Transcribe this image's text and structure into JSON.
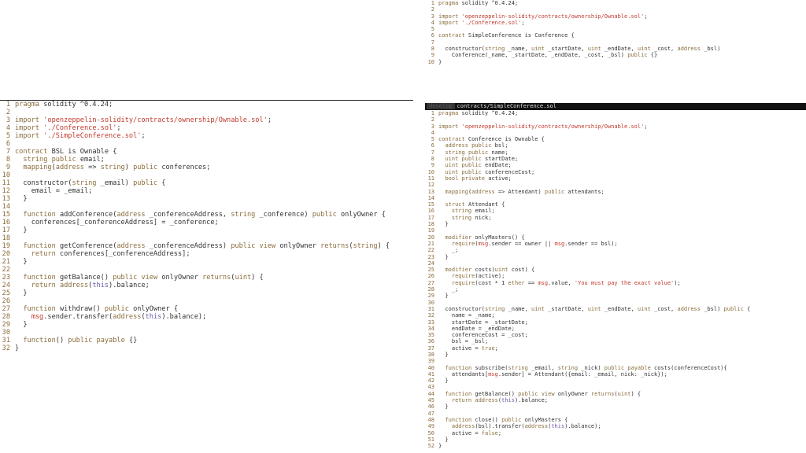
{
  "theme": {
    "keyword": "#8a6d3b",
    "string": "#c0392b",
    "type": "#6c5ba8",
    "text": "#333333"
  },
  "top_pane": {
    "lines": [
      [
        [
          "kw",
          "pragma"
        ],
        [
          "p",
          " solidity ^0.4.24;"
        ]
      ],
      [],
      [
        [
          "kw",
          "import"
        ],
        [
          "p",
          " "
        ],
        [
          "str",
          "'openzeppelin-solidity/contracts/ownership/Ownable.sol'"
        ],
        [
          "p",
          ";"
        ]
      ],
      [
        [
          "kw",
          "import"
        ],
        [
          "p",
          " "
        ],
        [
          "str",
          "'./Conference.sol'"
        ],
        [
          "p",
          ";"
        ]
      ],
      [],
      [
        [
          "kw",
          "contract"
        ],
        [
          "p",
          " SimpleConference is Conference {"
        ]
      ],
      [],
      [
        [
          "p",
          "  constructor("
        ],
        [
          "kw",
          "string"
        ],
        [
          "p",
          " _name, "
        ],
        [
          "kw",
          "uint"
        ],
        [
          "p",
          " _startDate, "
        ],
        [
          "kw",
          "uint"
        ],
        [
          "p",
          " _endDate, "
        ],
        [
          "kw",
          "uint"
        ],
        [
          "p",
          " _cost, "
        ],
        [
          "kw",
          "address"
        ],
        [
          "p",
          " _bsl)"
        ]
      ],
      [
        [
          "p",
          "    Conference(_name, _startDate, _endDate, _cost, _bsl) "
        ],
        [
          "kw",
          "public"
        ],
        [
          "p",
          " {}"
        ]
      ],
      [
        [
          "p",
          "}"
        ]
      ]
    ]
  },
  "left_pane": {
    "lines": [
      [
        [
          "kw",
          "pragma"
        ],
        [
          "p",
          " solidity ^0.4.24;"
        ]
      ],
      [],
      [
        [
          "kw",
          "import"
        ],
        [
          "p",
          " "
        ],
        [
          "str",
          "'openzeppelin-solidity/contracts/ownership/Ownable.sol'"
        ],
        [
          "p",
          ";"
        ]
      ],
      [
        [
          "kw",
          "import"
        ],
        [
          "p",
          " "
        ],
        [
          "str",
          "'./Conference.sol'"
        ],
        [
          "p",
          ";"
        ]
      ],
      [
        [
          "kw",
          "import"
        ],
        [
          "p",
          " "
        ],
        [
          "str",
          "'./SimpleConference.sol'"
        ],
        [
          "p",
          ";"
        ]
      ],
      [],
      [
        [
          "kw",
          "contract"
        ],
        [
          "p",
          " BSL is Ownable {"
        ]
      ],
      [
        [
          "p",
          "  "
        ],
        [
          "kw",
          "string"
        ],
        [
          "p",
          " "
        ],
        [
          "kw",
          "public"
        ],
        [
          "p",
          " email;"
        ]
      ],
      [
        [
          "p",
          "  "
        ],
        [
          "kw",
          "mapping"
        ],
        [
          "p",
          "("
        ],
        [
          "kw",
          "address"
        ],
        [
          "p",
          " => "
        ],
        [
          "kw",
          "string"
        ],
        [
          "p",
          ") "
        ],
        [
          "kw",
          "public"
        ],
        [
          "p",
          " conferences;"
        ]
      ],
      [],
      [
        [
          "p",
          "  constructor("
        ],
        [
          "kw",
          "string"
        ],
        [
          "p",
          " _email) "
        ],
        [
          "kw",
          "public"
        ],
        [
          "p",
          " {"
        ]
      ],
      [
        [
          "p",
          "    email = _email;"
        ]
      ],
      [
        [
          "p",
          "  }"
        ]
      ],
      [],
      [
        [
          "p",
          "  "
        ],
        [
          "kw",
          "function"
        ],
        [
          "p",
          " addConference("
        ],
        [
          "kw",
          "address"
        ],
        [
          "p",
          " _conferenceAddress, "
        ],
        [
          "kw",
          "string"
        ],
        [
          "p",
          " _conference) "
        ],
        [
          "kw",
          "public"
        ],
        [
          "p",
          " onlyOwner {"
        ]
      ],
      [
        [
          "p",
          "    conferences[_conferenceAddress] = _conference;"
        ]
      ],
      [
        [
          "p",
          "  }"
        ]
      ],
      [],
      [
        [
          "p",
          "  "
        ],
        [
          "kw",
          "function"
        ],
        [
          "p",
          " getConference("
        ],
        [
          "kw",
          "address"
        ],
        [
          "p",
          " _conferenceAddress) "
        ],
        [
          "kw",
          "public"
        ],
        [
          "p",
          " "
        ],
        [
          "kw",
          "view"
        ],
        [
          "p",
          " onlyOwner "
        ],
        [
          "kw",
          "returns"
        ],
        [
          "p",
          "("
        ],
        [
          "kw",
          "string"
        ],
        [
          "p",
          ") {"
        ]
      ],
      [
        [
          "p",
          "    "
        ],
        [
          "kw",
          "return"
        ],
        [
          "p",
          " conferences[_conferenceAddress];"
        ]
      ],
      [
        [
          "p",
          "  }"
        ]
      ],
      [],
      [
        [
          "p",
          "  "
        ],
        [
          "kw",
          "function"
        ],
        [
          "p",
          " getBalance() "
        ],
        [
          "kw",
          "public"
        ],
        [
          "p",
          " "
        ],
        [
          "kw",
          "view"
        ],
        [
          "p",
          " onlyOwner "
        ],
        [
          "kw",
          "returns"
        ],
        [
          "p",
          "("
        ],
        [
          "kw",
          "uint"
        ],
        [
          "p",
          ") {"
        ]
      ],
      [
        [
          "p",
          "    "
        ],
        [
          "kw",
          "return"
        ],
        [
          "p",
          " "
        ],
        [
          "kw",
          "address"
        ],
        [
          "p",
          "("
        ],
        [
          "type",
          "this"
        ],
        [
          "p",
          ").balance;"
        ]
      ],
      [
        [
          "p",
          "  }"
        ]
      ],
      [],
      [
        [
          "p",
          "  "
        ],
        [
          "kw",
          "function"
        ],
        [
          "p",
          " withdraw() "
        ],
        [
          "kw",
          "public"
        ],
        [
          "p",
          " onlyOwner {"
        ]
      ],
      [
        [
          "p",
          "    "
        ],
        [
          "str",
          "msg"
        ],
        [
          "p",
          ".sender.transfer("
        ],
        [
          "kw",
          "address"
        ],
        [
          "p",
          "("
        ],
        [
          "type",
          "this"
        ],
        [
          "p",
          ").balance);"
        ]
      ],
      [
        [
          "p",
          "  }"
        ]
      ],
      [],
      [
        [
          "p",
          "  "
        ],
        [
          "kw",
          "function"
        ],
        [
          "p",
          "() "
        ],
        [
          "kw",
          "public"
        ],
        [
          "p",
          " "
        ],
        [
          "kw",
          "payable"
        ],
        [
          "p",
          " {}"
        ]
      ],
      [
        [
          "p",
          "}"
        ]
      ]
    ]
  },
  "right_pane": {
    "tab_inactive": "develop",
    "tab_active": "contracts/SimpleConference.sol",
    "lines": [
      [
        [
          "kw",
          "pragma"
        ],
        [
          "p",
          " solidity ^0.4.24;"
        ]
      ],
      [],
      [
        [
          "kw",
          "import"
        ],
        [
          "p",
          " "
        ],
        [
          "str",
          "'openzeppelin-solidity/contracts/ownership/Ownable.sol'"
        ],
        [
          "p",
          ";"
        ]
      ],
      [],
      [
        [
          "kw",
          "contract"
        ],
        [
          "p",
          " Conference is Ownable {"
        ]
      ],
      [
        [
          "p",
          "  "
        ],
        [
          "kw",
          "address"
        ],
        [
          "p",
          " "
        ],
        [
          "kw",
          "public"
        ],
        [
          "p",
          " bsl;"
        ]
      ],
      [
        [
          "p",
          "  "
        ],
        [
          "kw",
          "string"
        ],
        [
          "p",
          " "
        ],
        [
          "kw",
          "public"
        ],
        [
          "p",
          " name;"
        ]
      ],
      [
        [
          "p",
          "  "
        ],
        [
          "kw",
          "uint"
        ],
        [
          "p",
          " "
        ],
        [
          "kw",
          "public"
        ],
        [
          "p",
          " startDate;"
        ]
      ],
      [
        [
          "p",
          "  "
        ],
        [
          "kw",
          "uint"
        ],
        [
          "p",
          " "
        ],
        [
          "kw",
          "public"
        ],
        [
          "p",
          " endDate;"
        ]
      ],
      [
        [
          "p",
          "  "
        ],
        [
          "kw",
          "uint"
        ],
        [
          "p",
          " "
        ],
        [
          "kw",
          "public"
        ],
        [
          "p",
          " conferenceCost;"
        ]
      ],
      [
        [
          "p",
          "  "
        ],
        [
          "kw",
          "bool"
        ],
        [
          "p",
          " "
        ],
        [
          "kw",
          "private"
        ],
        [
          "p",
          " active;"
        ]
      ],
      [],
      [
        [
          "p",
          "  "
        ],
        [
          "kw",
          "mapping"
        ],
        [
          "p",
          "("
        ],
        [
          "kw",
          "address"
        ],
        [
          "p",
          " => Attendant) "
        ],
        [
          "kw",
          "public"
        ],
        [
          "p",
          " attendants;"
        ]
      ],
      [],
      [
        [
          "p",
          "  "
        ],
        [
          "kw",
          "struct"
        ],
        [
          "p",
          " Attendant {"
        ]
      ],
      [
        [
          "p",
          "    "
        ],
        [
          "kw",
          "string"
        ],
        [
          "p",
          " email;"
        ]
      ],
      [
        [
          "p",
          "    "
        ],
        [
          "kw",
          "string"
        ],
        [
          "p",
          " nick;"
        ]
      ],
      [
        [
          "p",
          "  }"
        ]
      ],
      [],
      [
        [
          "p",
          "  "
        ],
        [
          "kw",
          "modifier"
        ],
        [
          "p",
          " onlyMasters() {"
        ]
      ],
      [
        [
          "p",
          "    "
        ],
        [
          "kw",
          "require"
        ],
        [
          "p",
          "("
        ],
        [
          "str",
          "msg"
        ],
        [
          "p",
          ".sender == owner || "
        ],
        [
          "str",
          "msg"
        ],
        [
          "p",
          ".sender == bsl);"
        ]
      ],
      [
        [
          "p",
          "    _;"
        ]
      ],
      [
        [
          "p",
          "  }"
        ]
      ],
      [],
      [
        [
          "p",
          "  "
        ],
        [
          "kw",
          "modifier"
        ],
        [
          "p",
          " costs("
        ],
        [
          "kw",
          "uint"
        ],
        [
          "p",
          " cost) {"
        ]
      ],
      [
        [
          "p",
          "    "
        ],
        [
          "kw",
          "require"
        ],
        [
          "p",
          "(active);"
        ]
      ],
      [
        [
          "p",
          "    "
        ],
        [
          "kw",
          "require"
        ],
        [
          "p",
          "(cost * 1 "
        ],
        [
          "kw",
          "ether"
        ],
        [
          "p",
          " == "
        ],
        [
          "str",
          "msg"
        ],
        [
          "p",
          ".value, "
        ],
        [
          "str",
          "'You must pay the exact value'"
        ],
        [
          "p",
          ");"
        ]
      ],
      [
        [
          "p",
          "    _;"
        ]
      ],
      [
        [
          "p",
          "  }"
        ]
      ],
      [],
      [
        [
          "p",
          "  constructor("
        ],
        [
          "kw",
          "string"
        ],
        [
          "p",
          " _name, "
        ],
        [
          "kw",
          "uint"
        ],
        [
          "p",
          " _startDate, "
        ],
        [
          "kw",
          "uint"
        ],
        [
          "p",
          " _endDate, "
        ],
        [
          "kw",
          "uint"
        ],
        [
          "p",
          " _cost, "
        ],
        [
          "kw",
          "address"
        ],
        [
          "p",
          " _bsl) "
        ],
        [
          "kw",
          "public"
        ],
        [
          "p",
          " {"
        ]
      ],
      [
        [
          "p",
          "    name = _name;"
        ]
      ],
      [
        [
          "p",
          "    startDate = _startDate;"
        ]
      ],
      [
        [
          "p",
          "    endDate = _endDate;"
        ]
      ],
      [
        [
          "p",
          "    conferenceCost = _cost;"
        ]
      ],
      [
        [
          "p",
          "    bsl = _bsl;"
        ]
      ],
      [
        [
          "p",
          "    active = "
        ],
        [
          "kw",
          "true"
        ],
        [
          "p",
          ";"
        ]
      ],
      [
        [
          "p",
          "  }"
        ]
      ],
      [],
      [
        [
          "p",
          "  "
        ],
        [
          "kw",
          "function"
        ],
        [
          "p",
          " subscribe("
        ],
        [
          "kw",
          "string"
        ],
        [
          "p",
          " _email, "
        ],
        [
          "kw",
          "string"
        ],
        [
          "p",
          " _nick) "
        ],
        [
          "kw",
          "public"
        ],
        [
          "p",
          " "
        ],
        [
          "kw",
          "payable"
        ],
        [
          "p",
          " costs(conferenceCost){"
        ]
      ],
      [
        [
          "p",
          "    attendants["
        ],
        [
          "str",
          "msg"
        ],
        [
          "p",
          ".sender] = Attendant({email: _email, nick: _nick});"
        ]
      ],
      [
        [
          "p",
          "  }"
        ]
      ],
      [],
      [
        [
          "p",
          "  "
        ],
        [
          "kw",
          "function"
        ],
        [
          "p",
          " getBalance() "
        ],
        [
          "kw",
          "public"
        ],
        [
          "p",
          " "
        ],
        [
          "kw",
          "view"
        ],
        [
          "p",
          " onlyOwner "
        ],
        [
          "kw",
          "returns"
        ],
        [
          "p",
          "("
        ],
        [
          "kw",
          "uint"
        ],
        [
          "p",
          ") {"
        ]
      ],
      [
        [
          "p",
          "    "
        ],
        [
          "kw",
          "return"
        ],
        [
          "p",
          " "
        ],
        [
          "kw",
          "address"
        ],
        [
          "p",
          "("
        ],
        [
          "type",
          "this"
        ],
        [
          "p",
          ").balance;"
        ]
      ],
      [
        [
          "p",
          "  }"
        ]
      ],
      [],
      [
        [
          "p",
          "  "
        ],
        [
          "kw",
          "function"
        ],
        [
          "p",
          " close() "
        ],
        [
          "kw",
          "public"
        ],
        [
          "p",
          " onlyMasters {"
        ]
      ],
      [
        [
          "p",
          "    "
        ],
        [
          "kw",
          "address"
        ],
        [
          "p",
          "(bsl).transfer("
        ],
        [
          "kw",
          "address"
        ],
        [
          "p",
          "("
        ],
        [
          "type",
          "this"
        ],
        [
          "p",
          ").balance);"
        ]
      ],
      [
        [
          "p",
          "    active = "
        ],
        [
          "kw",
          "false"
        ],
        [
          "p",
          ";"
        ]
      ],
      [
        [
          "p",
          "  }"
        ]
      ],
      [
        [
          "p",
          "}"
        ]
      ]
    ]
  }
}
